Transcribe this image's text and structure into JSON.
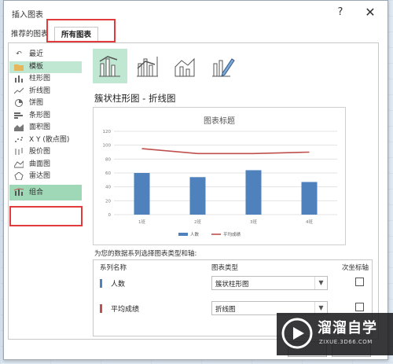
{
  "dialog": {
    "title": "插入图表",
    "help": "?",
    "close": "✕"
  },
  "tabs": [
    {
      "label": "推荐的图表"
    },
    {
      "label": "所有图表"
    }
  ],
  "sidebar": {
    "items": [
      {
        "label": "最近",
        "icon": "undo-icon"
      },
      {
        "label": "模板",
        "icon": "folder-icon"
      },
      {
        "label": "柱形图",
        "icon": "column-chart-icon"
      },
      {
        "label": "折线图",
        "icon": "line-chart-icon"
      },
      {
        "label": "饼图",
        "icon": "pie-chart-icon"
      },
      {
        "label": "条形图",
        "icon": "bar-chart-icon"
      },
      {
        "label": "面积图",
        "icon": "area-chart-icon"
      },
      {
        "label": "X Y (散点图)",
        "icon": "scatter-chart-icon"
      },
      {
        "label": "股价图",
        "icon": "stock-chart-icon"
      },
      {
        "label": "曲面图",
        "icon": "surface-chart-icon"
      },
      {
        "label": "雷达图",
        "icon": "radar-chart-icon"
      },
      {
        "label": "组合",
        "icon": "combo-chart-icon"
      }
    ]
  },
  "combo_subtype_label": "簇状柱形图 - 折线图",
  "chart_data": {
    "type": "bar",
    "title": "图表标题",
    "categories": [
      "1班",
      "2班",
      "3班",
      "4班"
    ],
    "ylim": [
      0,
      120
    ],
    "yticks": [
      0,
      20,
      40,
      60,
      80,
      100,
      120
    ],
    "series": [
      {
        "name": "人数",
        "kind": "bar",
        "color": "#4f81bd",
        "values": [
          60,
          54,
          64,
          47
        ]
      },
      {
        "name": "平均成绩",
        "kind": "line",
        "color": "#c0504d",
        "values": [
          95,
          88,
          88,
          90
        ]
      }
    ],
    "legend": "bottom"
  },
  "series_config": {
    "instruction": "为您的数据系列选择图表类型和轴:",
    "headers": {
      "name": "系列名称",
      "type": "图表类型",
      "secondary": "次坐标轴"
    },
    "rows": [
      {
        "name": "人数",
        "color": "#4f81bd",
        "chart_type": "簇状柱形图",
        "secondary_axis": false
      },
      {
        "name": "平均成绩",
        "color": "#c0504d",
        "chart_type": "折线图",
        "secondary_axis": false
      }
    ]
  },
  "watermark": {
    "text": "溜溜自学",
    "url": "ZIXUE.3D66.COM"
  }
}
